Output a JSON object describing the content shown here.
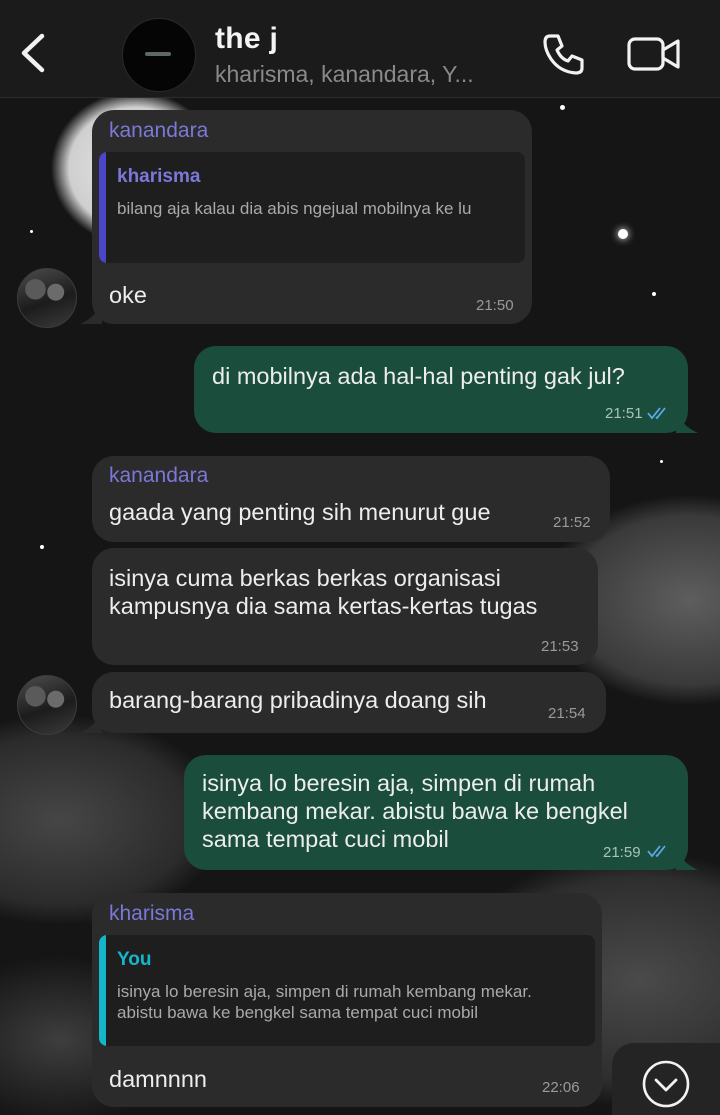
{
  "header": {
    "back_icon": "chevron-left-icon",
    "title": "the j",
    "subtitle": "kharisma, kanandara, Y...",
    "call_icon": "phone-icon",
    "video_icon": "video-camera-icon"
  },
  "messages": [
    {
      "sender": "kanandara",
      "quote": {
        "author": "kharisma",
        "text": "bilang aja kalau dia abis ngejual mobilnya ke lu"
      },
      "text": "oke",
      "time": "21:50"
    },
    {
      "text": "di mobilnya ada hal-hal penting gak jul?",
      "time": "21:51"
    },
    {
      "sender": "kanandara",
      "text": "gaada yang penting sih menurut gue",
      "time": "21:52"
    },
    {
      "text": "isinya cuma berkas berkas organisasi\nkampusnya dia sama kertas-kertas tugas",
      "time": "21:53"
    },
    {
      "text": "barang-barang pribadinya doang sih",
      "time": "21:54"
    },
    {
      "text": "isinya lo beresin aja, simpen di rumah\nkembang mekar. abistu bawa ke bengkel\nsama tempat cuci mobil",
      "time": "21:59"
    },
    {
      "sender": "kharisma",
      "quote": {
        "author": "You",
        "text": "isinya lo beresin aja, simpen di rumah kembang mekar.\nabistu bawa ke bengkel sama tempat cuci mobil"
      },
      "text": "damnnnn",
      "time": "22:06"
    }
  ],
  "scroll_down_icon": "chevron-down-circle-icon",
  "colors": {
    "incoming_bubble": "#2b2b2b",
    "outgoing_bubble": "#1a4d3b",
    "sender_name": "#7b78d8",
    "quote_bar_kharisma": "#4b45c7",
    "quote_bar_you": "#16b6c9",
    "read_ticks": "#5aa8e8"
  }
}
